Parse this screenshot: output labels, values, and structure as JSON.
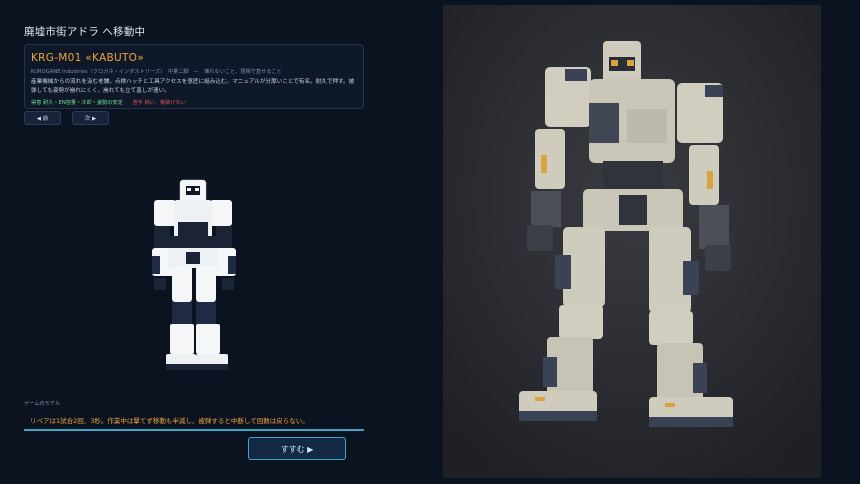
{
  "header": {
    "title": "廃墟市街アドラ へ移動中"
  },
  "unit": {
    "name": "KRG-M01 «KABUTO»",
    "meta": "KUROGANE Industries（クロガネ・インダストリーズ）　中量二脚　—　壊れないこと、現場で直せること",
    "description": "産業機械からの流れを汲む老舗。点検ハッチと工具アクセスを意匠に組み込む。マニュアルが分厚いことで有名。耐久で押す。被弾しても姿勢が崩れにくく、崩れても立て直しが速い。",
    "strengths": "得意 耐久・EN容量・冷却・姿勢の安定",
    "weaknesses": "苦手 鈍い、竜破けない"
  },
  "nav": {
    "prev_label": "◀ 前",
    "next_label": "次 ▶"
  },
  "model": {
    "label": "ゲーム内モデル"
  },
  "message": {
    "text": "リペアは1試合2回、3秒。作業中は撃てず移動も半減し、被弾すると中断して回数は戻らない。"
  },
  "actions": {
    "proceed_label": "すすむ ▶"
  },
  "colors": {
    "background": "#0b1220",
    "accent": "#f0a53b",
    "good": "#6fe08c",
    "bad": "#e0564b",
    "cyan": "#3ea6c9"
  }
}
